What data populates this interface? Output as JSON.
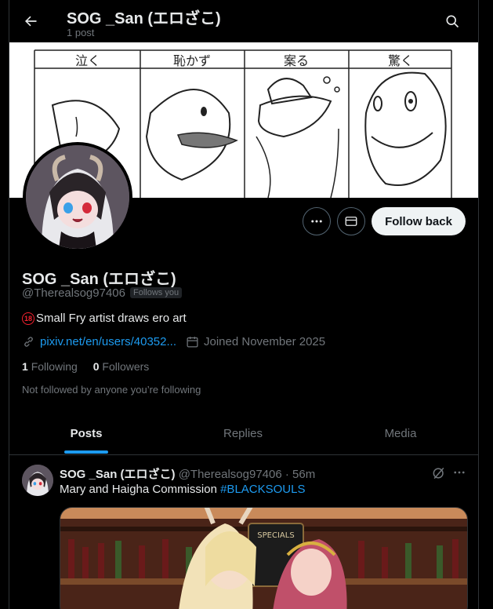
{
  "header": {
    "title": "SOG _San (エロざこ)",
    "post_count": "1 post"
  },
  "banner": {
    "panels": [
      "泣く",
      "恥かず",
      "案る",
      "驚く"
    ]
  },
  "profile": {
    "name": "SOG _San (エロざこ)",
    "handle": "@Therealsog97406",
    "follows_you": "Follows you",
    "bio_badge": "18",
    "bio": "Small Fry artist draws ero art",
    "link": "pixiv.net/en/users/40352...",
    "joined": "Joined November 2025",
    "following_count": "1",
    "following_label": "Following",
    "followers_count": "0",
    "followers_label": "Followers",
    "not_followed": "Not followed by anyone you’re following"
  },
  "actions": {
    "follow_back": "Follow back"
  },
  "tabs": [
    {
      "label": "Posts",
      "active": true
    },
    {
      "label": "Replies",
      "active": false
    },
    {
      "label": "Media",
      "active": false
    }
  ],
  "post": {
    "name": "SOG _San (エロざこ)",
    "handle": "@Therealsog97406",
    "separator": "·",
    "time": "56m",
    "text": "Mary and Haigha Commission",
    "hashtag": "#BLACKSOULS",
    "media_sign": "SPECIALS"
  },
  "colors": {
    "accent": "#1d9bf0",
    "background": "#000000",
    "text": "#e7e9ea",
    "muted": "#71767b",
    "border": "#2f3336"
  },
  "icons": [
    "back-arrow-icon",
    "search-icon",
    "more-icon",
    "message-icon",
    "link-icon",
    "calendar-icon",
    "grok-icon"
  ]
}
